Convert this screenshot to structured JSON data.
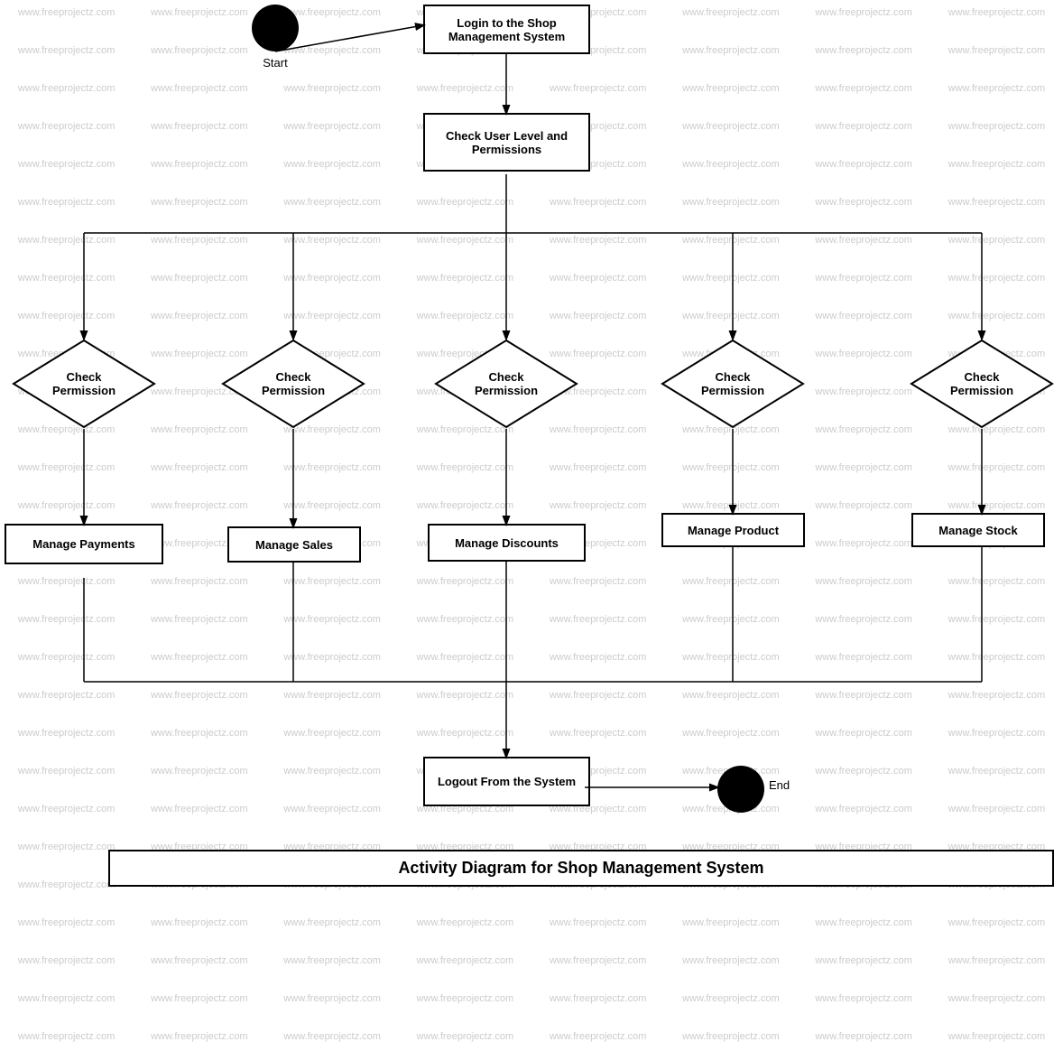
{
  "watermark": "www.freeprojectz.com",
  "diagram": {
    "title": "Activity Diagram for Shop Management System",
    "nodes": {
      "start_label": "Start",
      "end_label": "End",
      "login": "Login to the Shop Management System",
      "check_permission_main": "Check User Level and Permissions",
      "check_perm1": "Check Permission",
      "check_perm2": "Check Permission",
      "check_perm3": "Check Permission",
      "check_perm4": "Check Permission",
      "check_perm5": "Check Permission",
      "manage_payments": "Manage Payments",
      "manage_sales": "Manage Sales",
      "manage_discounts": "Manage Discounts",
      "manage_product": "Manage Product",
      "manage_stock": "Manage Stock",
      "logout": "Logout From the System"
    }
  }
}
